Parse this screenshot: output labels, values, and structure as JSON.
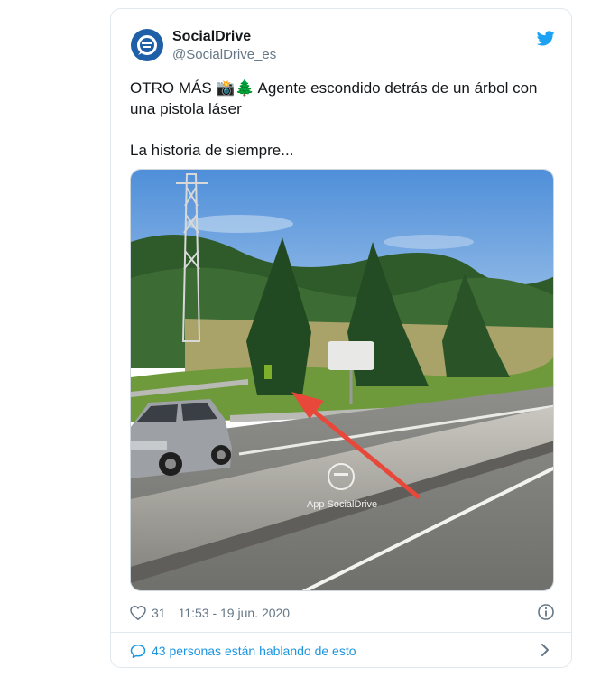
{
  "tweet": {
    "author_name": "SocialDrive",
    "author_handle": "@SocialDrive_es",
    "text": "OTRO MÁS 📸🌲 Agente escondido detrás de un árbol con una pistola láser\n\nLa historia de siempre...",
    "likes": "31",
    "timestamp": "11:53 - 19 jun. 2020",
    "conversation": "43 personas están hablando de esto",
    "media_watermark": "App SocialDrive"
  },
  "icons": {
    "avatar": "socialdrive-logo-icon",
    "brand": "twitter-bird-icon",
    "like": "heart-icon",
    "info": "info-icon",
    "reply": "speech-bubble-icon",
    "chevron": "chevron-right-icon"
  },
  "colors": {
    "twitter_blue": "#1da1f2",
    "link_blue": "#1b95e0",
    "secondary_text": "#657786",
    "avatar_blue": "#1f5fa8",
    "arrow_red": "#e8483a"
  }
}
